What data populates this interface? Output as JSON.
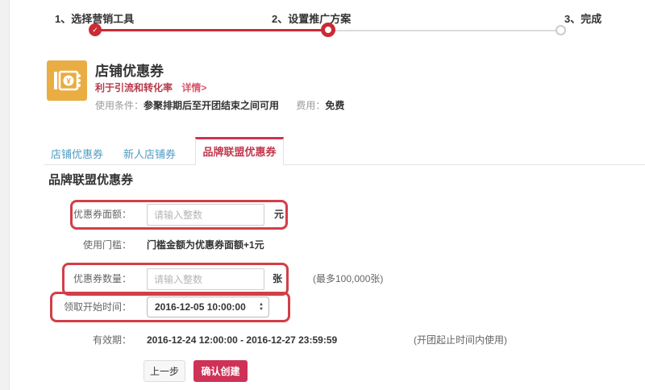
{
  "icons": {
    "check": "✓",
    "arrow_up": "▲",
    "arrow_down": "▼",
    "currency": "¥"
  },
  "colors": {
    "progress_red": "#cb2b33",
    "annotation_red": "#d23f48",
    "tab_blue": "#4f9cc4",
    "tab_active_red": "#c2384e",
    "icon_orange": "#e9ad43",
    "confirm_button_red": "#ce3256"
  },
  "steps": [
    {
      "label": "1、选择营销工具",
      "state": "done"
    },
    {
      "label": "2、设置推广方案",
      "state": "current"
    },
    {
      "label": "3、完成",
      "state": "pending"
    }
  ],
  "header": {
    "icon": "coupon-icon",
    "title": "店铺优惠券",
    "benefit": "利于引流和转化率",
    "detail_link": "详情>",
    "condition_label": "使用条件：",
    "condition_value": "参聚排期后至开团结束之间可用",
    "fee_label": "费用：",
    "fee_value": "免费"
  },
  "tabs": [
    {
      "label": "店铺优惠券",
      "active": false
    },
    {
      "label": "新人店铺券",
      "active": false
    },
    {
      "label": "品牌联盟优惠券",
      "active": true
    }
  ],
  "form": {
    "section_title": "品牌联盟优惠券",
    "denomination": {
      "label": "优惠券面额：",
      "placeholder": "请输入整数",
      "unit": "元"
    },
    "threshold": {
      "label": "使用门槛：",
      "value": "门槛金额为优惠券面额+1元"
    },
    "quantity": {
      "label": "优惠券数量：",
      "placeholder": "请输入整数",
      "unit": "张",
      "hint": "(最多100,000张)"
    },
    "start_time": {
      "label": "领取开始时间：",
      "value": "2016-12-05 10:00:00"
    },
    "validity": {
      "label": "有效期：",
      "value": "2016-12-24 12:00:00 - 2016-12-27 23:59:59",
      "hint": "(开团起止时间内使用)"
    },
    "buttons": {
      "back": "上一步",
      "confirm": "确认创建"
    }
  }
}
